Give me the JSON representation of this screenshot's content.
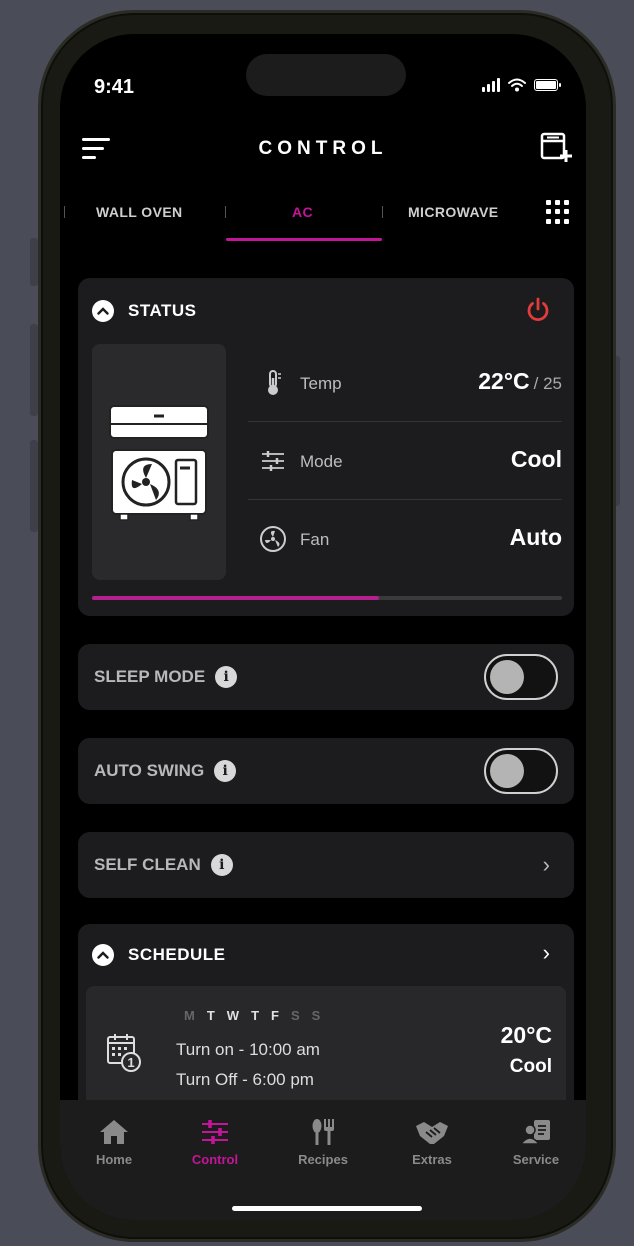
{
  "status_bar": {
    "time": "9:41"
  },
  "header": {
    "title": "CONTROL"
  },
  "tabs": [
    {
      "label": "WALL OVEN",
      "active": false
    },
    {
      "label": "AC",
      "active": true
    },
    {
      "label": "MICROWAVE",
      "active": false
    }
  ],
  "status_card": {
    "title": "STATUS",
    "rows": [
      {
        "label": "Temp",
        "value": "22°C",
        "sub": "/ 25",
        "icon": "thermometer-icon"
      },
      {
        "label": "Mode",
        "value": "Cool",
        "icon": "sliders-icon"
      },
      {
        "label": "Fan",
        "value": "Auto",
        "icon": "fan-icon"
      }
    ],
    "progress_percent": 61
  },
  "settings": {
    "sleep_mode": {
      "label": "SLEEP MODE",
      "enabled": false
    },
    "auto_swing": {
      "label": "AUTO SWING",
      "enabled": false
    },
    "self_clean": {
      "label": "SELF CLEAN"
    }
  },
  "schedule": {
    "title": "SCHEDULE",
    "days": [
      {
        "d": "M",
        "on": false
      },
      {
        "d": "T",
        "on": true
      },
      {
        "d": "W",
        "on": true
      },
      {
        "d": "T",
        "on": true
      },
      {
        "d": "F",
        "on": true
      },
      {
        "d": "S",
        "on": false
      },
      {
        "d": "S",
        "on": false
      }
    ],
    "turn_on": "Turn on - 10:00 am",
    "turn_off": "Turn Off - 6:00 pm",
    "temp": "20°C",
    "mode": "Cool"
  },
  "bottom_nav": [
    {
      "label": "Home",
      "icon": "home-icon",
      "active": false
    },
    {
      "label": "Control",
      "icon": "control-icon",
      "active": true
    },
    {
      "label": "Recipes",
      "icon": "utensils-icon",
      "active": false
    },
    {
      "label": "Extras",
      "icon": "handshake-icon",
      "active": false
    },
    {
      "label": "Service",
      "icon": "service-icon",
      "active": false
    }
  ],
  "colors": {
    "accent": "#c4159a",
    "power": "#e23b3b",
    "card": "#1c1c1e",
    "background": "#000000"
  }
}
